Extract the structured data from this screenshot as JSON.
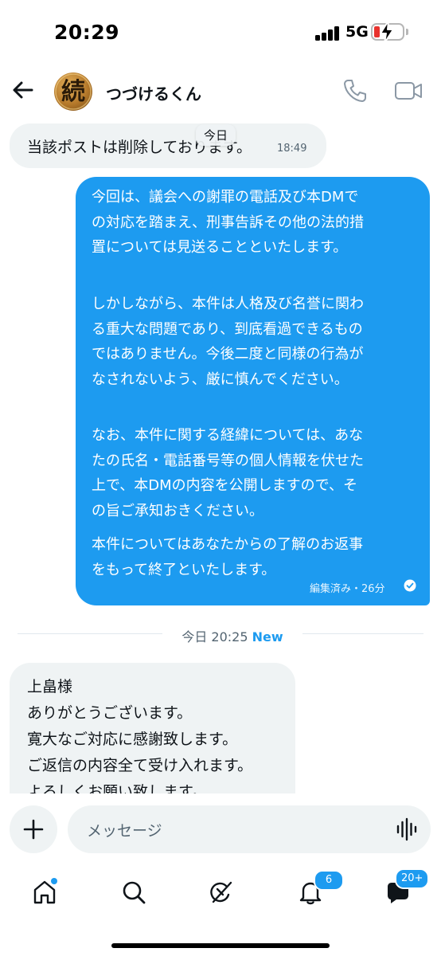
{
  "status_bar": {
    "time": "20:29",
    "network": "5G",
    "battery_level": 0.2,
    "battery_color": "#e8322e"
  },
  "header": {
    "back_icon": "arrow-left-icon",
    "avatar_glyph": "続",
    "contact_name": "つづけるくん",
    "phone_icon": "phone-icon",
    "video_icon": "video-camera-icon"
  },
  "messages": {
    "received_1": {
      "text": "当該ポストは削除しております。",
      "time": "18:49"
    },
    "date_chip": "今日",
    "sent_1": {
      "paragraphs": [
        [
          "今回は、議会への謝罪の電話及び本DMで",
          "の対応を踏まえ、刑事告訴その他の法的措",
          "置については見送ることといたします。"
        ],
        [
          "しかしながら、本件は人格及び名誉に関わ",
          "る重大な問題であり、到底看過できるもの",
          "ではありません。今後二度と同様の行為が",
          "なされないよう、厳に慎んでください。"
        ],
        [
          "なお、本件に関する経緯については、あな",
          "たの氏名・電話番号等の個人情報を伏せた",
          "上で、本DMの内容を公開しますので、そ",
          "の旨ご承知おきください。"
        ],
        [
          "本件についてはあなたからの了解のお返事",
          "をもって終了といたします。"
        ]
      ],
      "meta": "編集済み・26分",
      "status_icon": "read-check-icon"
    },
    "divider": {
      "label": "今日 20:25",
      "new_label": "New"
    },
    "received_2": {
      "lines": [
        "上畠様",
        "ありがとうございます。",
        "寛大なご対応に感謝致します。",
        "ご返信の内容全て受け入れます。",
        "よろしくお願い致します。"
      ]
    }
  },
  "composer": {
    "placeholder": "メッセージ",
    "add_icon": "plus-icon",
    "voice_icon": "voice-waveform-icon"
  },
  "tabbar": {
    "items": [
      {
        "icon": "home-icon",
        "has_dot": true
      },
      {
        "icon": "search-icon"
      },
      {
        "icon": "grok-icon"
      },
      {
        "icon": "notifications-icon",
        "badge": "6"
      },
      {
        "icon": "messages-icon",
        "badge": "20+"
      }
    ]
  },
  "colors": {
    "accent": "#1d9bf0",
    "received_bubble": "#eff3f4",
    "muted_text": "#536471"
  }
}
